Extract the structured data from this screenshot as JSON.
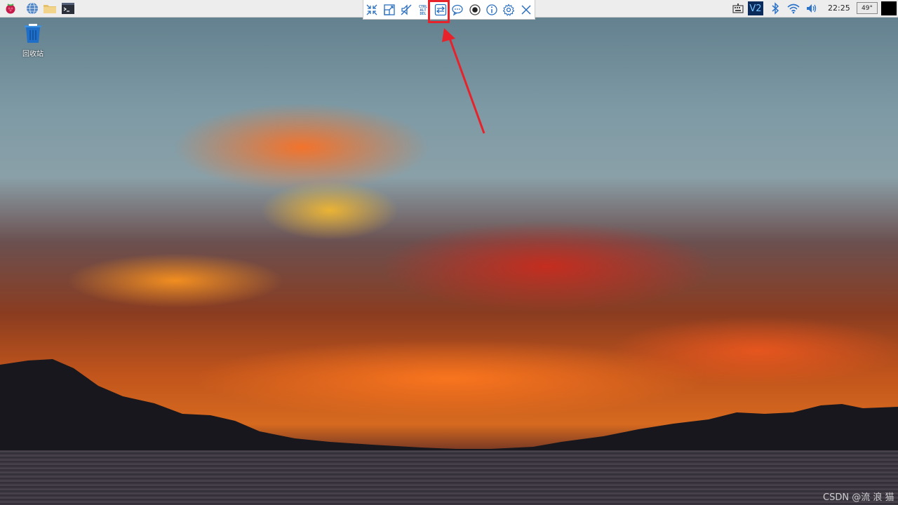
{
  "desktop": {
    "trash_label": "回收站"
  },
  "taskbar": {
    "launchers": [
      "raspberry-menu-icon",
      "web-browser-icon",
      "file-manager-icon",
      "terminal-icon"
    ],
    "tray": {
      "vnc_label": "V2",
      "clock": "22:25",
      "cpu_temp": "49°"
    }
  },
  "vnc_toolbar": {
    "buttons": [
      {
        "name": "fullscreen-exit",
        "icon": "collapse-arrows-icon"
      },
      {
        "name": "scale",
        "icon": "scale-icon"
      },
      {
        "name": "mute",
        "icon": "mute-icon"
      },
      {
        "name": "ctrl-alt-del",
        "icon": "ctrl-alt-del-icon",
        "label": "CTRL ALT DEL"
      },
      {
        "name": "transfer",
        "icon": "swap-arrows-icon"
      },
      {
        "name": "chat",
        "icon": "chat-icon"
      },
      {
        "name": "record",
        "icon": "record-icon"
      },
      {
        "name": "info",
        "icon": "info-icon"
      },
      {
        "name": "settings",
        "icon": "gear-icon"
      },
      {
        "name": "close",
        "icon": "close-icon"
      }
    ],
    "highlighted": "transfer",
    "highlight_color": "#e8222a"
  },
  "watermark": "CSDN @流 浪 猫"
}
